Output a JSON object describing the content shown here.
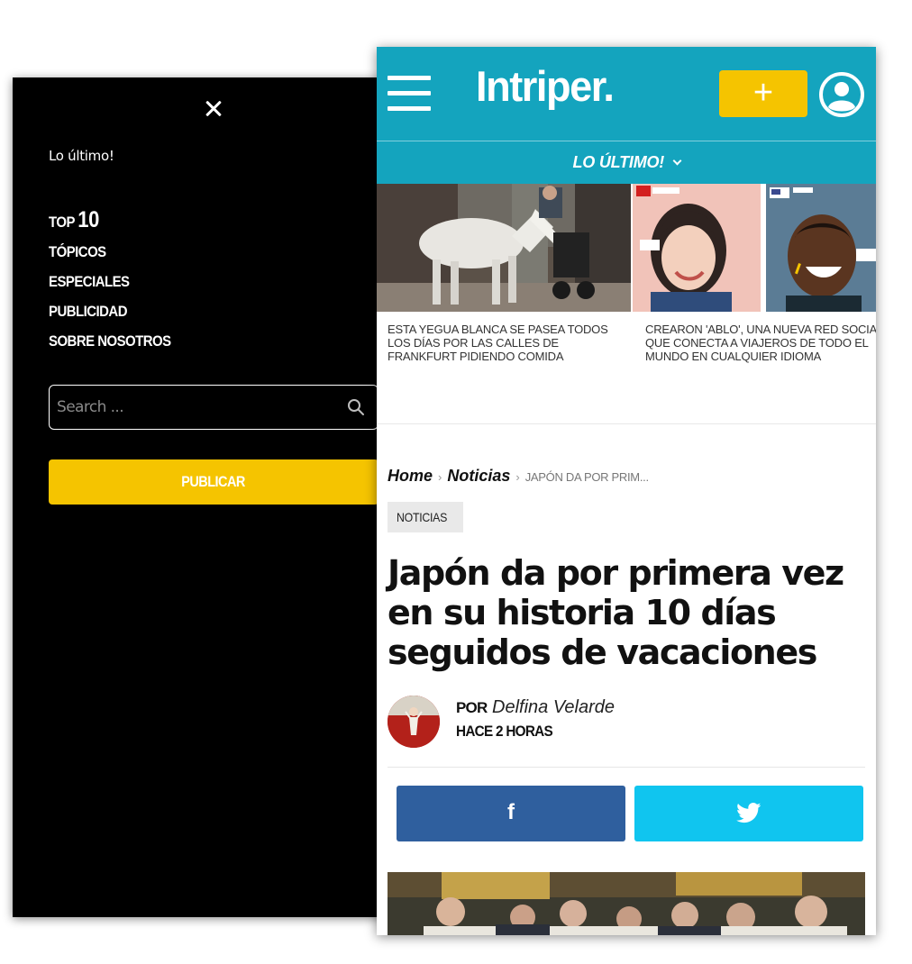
{
  "drawer": {
    "latest_label": "Lo último!",
    "nav": {
      "top_prefix": "TOP",
      "top_number": "10",
      "topicos": "TÓPICOS",
      "especiales": "ESPECIALES",
      "publicidad": "PUBLICIDAD",
      "sobre_nosotros": "SOBRE NOSOTROS"
    },
    "search_placeholder": "Search ...",
    "publish_label": "PUBLICAR"
  },
  "header": {
    "logo": "Intriper.",
    "plus_label": "+",
    "subnav_label": "LO ÚLTIMO!"
  },
  "stories": [
    {
      "caption": "ESTA YEGUA BLANCA SE PASEA TODOS LOS DÍAS POR LAS CALLES DE FRANKFURT PIDIENDO COMIDA"
    },
    {
      "caption": "CREARON 'ABLO', UNA NUEVA RED SOCIAL QUE CONECTA A VIAJEROS DE TODO EL MUNDO EN CUALQUIER IDIOMA"
    }
  ],
  "article": {
    "breadcrumb": {
      "home": "Home",
      "section": "Noticias",
      "current": "JAPÓN DA POR PRIM..."
    },
    "tag": "NOTICIAS",
    "headline": "Japón da por primera vez en su historia 10 días seguidos de vacaciones",
    "author_prefix": "POR",
    "author_name": "Delfina Velarde",
    "published": "HACE 2 HORAS"
  },
  "share": {
    "facebook_glyph": "f"
  },
  "colors": {
    "brand_teal": "#14a4be",
    "brand_yellow": "#f5c400",
    "facebook_blue": "#2f5f9e",
    "twitter_blue": "#10c5ef"
  }
}
